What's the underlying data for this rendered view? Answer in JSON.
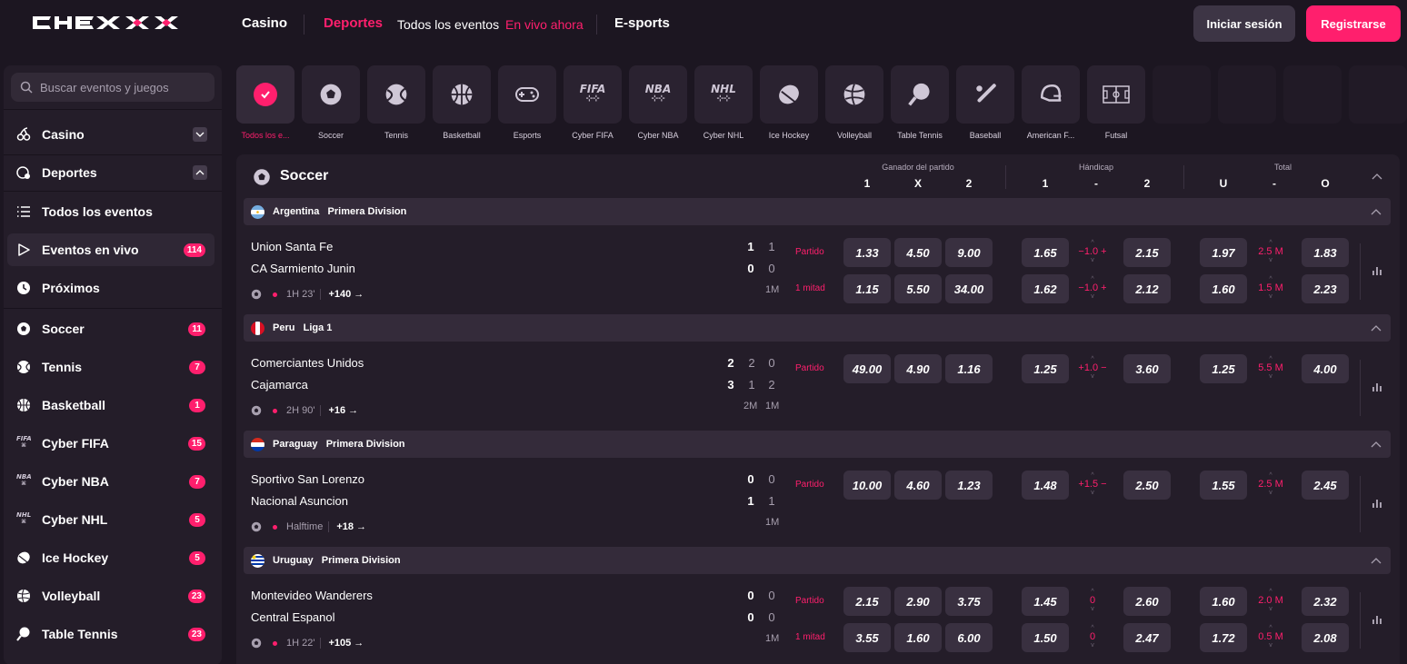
{
  "header": {
    "logo": "CHEXXX",
    "nav": [
      {
        "label": "Casino",
        "color": "#ffffff"
      },
      {
        "label": "Deportes",
        "color": "#ff1f6d"
      },
      {
        "label": "Todos los eventos",
        "color": "#ffffff"
      },
      {
        "label": "En vivo ahora",
        "color": "#ff1f6d"
      },
      {
        "label": "E-sports",
        "color": "#ffffff"
      }
    ],
    "login": "Iniciar sesión",
    "register": "Registrarse"
  },
  "sidebar": {
    "search_placeholder": "Buscar eventos y juegos",
    "items": [
      {
        "label": "Casino",
        "icon": "cherries-icon"
      },
      {
        "label": "Deportes",
        "icon": "sports-icon"
      },
      {
        "label": "Todos los eventos",
        "icon": "list-icon"
      },
      {
        "label": "Eventos en vivo",
        "icon": "play-icon",
        "badge": "114"
      },
      {
        "label": "Próximos",
        "icon": "clock-icon"
      },
      {
        "label": "Soccer",
        "icon": "soccer-icon",
        "badge": "11"
      },
      {
        "label": "Tennis",
        "icon": "tennis-icon",
        "badge": "7"
      },
      {
        "label": "Basketball",
        "icon": "basketball-icon",
        "badge": "1"
      },
      {
        "label": "Cyber FIFA",
        "icon": "fifa-icon",
        "badge": "15"
      },
      {
        "label": "Cyber NBA",
        "icon": "nba-icon",
        "badge": "7"
      },
      {
        "label": "Cyber NHL",
        "icon": "nhl-icon",
        "badge": "5"
      },
      {
        "label": "Ice Hockey",
        "icon": "hockey-icon",
        "badge": "5"
      },
      {
        "label": "Volleyball",
        "icon": "volleyball-icon",
        "badge": "23"
      },
      {
        "label": "Table Tennis",
        "icon": "table-tennis-icon",
        "badge": "23"
      }
    ]
  },
  "sports": [
    {
      "label": "Todos los e...",
      "icon": "check-icon"
    },
    {
      "label": "Soccer",
      "icon": "soccer-icon"
    },
    {
      "label": "Tennis",
      "icon": "tennis-icon"
    },
    {
      "label": "Basketball",
      "icon": "basketball-icon"
    },
    {
      "label": "Esports",
      "icon": "gamepad-icon"
    },
    {
      "label": "Cyber FIFA",
      "icon": "fifa-icon",
      "logo": "FIFA"
    },
    {
      "label": "Cyber NBA",
      "icon": "nba-icon",
      "logo": "NBA"
    },
    {
      "label": "Cyber NHL",
      "icon": "nhl-icon",
      "logo": "NHL"
    },
    {
      "label": "Ice Hockey",
      "icon": "hockey-icon"
    },
    {
      "label": "Volleyball",
      "icon": "volleyball-icon"
    },
    {
      "label": "Table Tennis",
      "icon": "table-tennis-icon"
    },
    {
      "label": "Baseball",
      "icon": "baseball-icon"
    },
    {
      "label": "American F...",
      "icon": "football-helmet-icon"
    },
    {
      "label": "Futsal",
      "icon": "futsal-icon"
    }
  ],
  "section": {
    "title": "Soccer",
    "groups": [
      {
        "label": "Ganador del partido",
        "cols": [
          "1",
          "X",
          "2"
        ]
      },
      {
        "label": "Hándicap",
        "cols": [
          "1",
          "-",
          "2"
        ]
      },
      {
        "label": "Total",
        "cols": [
          "U",
          "-",
          "O"
        ]
      }
    ]
  },
  "leagues": [
    {
      "country": "Argentina",
      "name": "Primera Division",
      "match": {
        "home": "Union Santa Fe",
        "away": "CA Sarmiento Junin",
        "scores": [
          [
            "1",
            "1"
          ],
          [
            "0",
            "0"
          ]
        ],
        "periods": [
          "1M"
        ],
        "status": "1H 23'",
        "more": "+140 →",
        "markets": [
          {
            "name": "Partido",
            "w": [
              "1.33",
              "4.50",
              "9.00"
            ],
            "h": [
              "1.65",
              "−1.0 +",
              "2.15"
            ],
            "t": [
              "1.97",
              "2.5 M",
              "1.83"
            ]
          },
          {
            "name": "1 mitad",
            "w": [
              "1.15",
              "5.50",
              "34.00"
            ],
            "h": [
              "1.62",
              "−1.0 +",
              "2.12"
            ],
            "t": [
              "1.60",
              "1.5 M",
              "2.23"
            ]
          }
        ]
      }
    },
    {
      "country": "Peru",
      "name": "Liga 1",
      "match": {
        "home": "Comerciantes Unidos",
        "away": "Cajamarca",
        "scores": [
          [
            "2",
            "2",
            "0"
          ],
          [
            "3",
            "1",
            "2"
          ]
        ],
        "periods": [
          "2M",
          "1M"
        ],
        "status": "2H 90'",
        "more": "+16 →",
        "markets": [
          {
            "name": "Partido",
            "w": [
              "49.00",
              "4.90",
              "1.16"
            ],
            "h": [
              "1.25",
              "+1.0 −",
              "3.60"
            ],
            "t": [
              "1.25",
              "5.5 M",
              "4.00"
            ]
          }
        ]
      }
    },
    {
      "country": "Paraguay",
      "name": "Primera Division",
      "match": {
        "home": "Sportivo San Lorenzo",
        "away": "Nacional Asuncion",
        "scores": [
          [
            "0",
            "0"
          ],
          [
            "1",
            "1"
          ]
        ],
        "periods": [
          "1M"
        ],
        "status": "Halftime",
        "more": "+18 →",
        "markets": [
          {
            "name": "Partido",
            "w": [
              "10.00",
              "4.60",
              "1.23"
            ],
            "h": [
              "1.48",
              "+1.5 −",
              "2.50"
            ],
            "t": [
              "1.55",
              "2.5 M",
              "2.45"
            ]
          }
        ]
      }
    },
    {
      "country": "Uruguay",
      "name": "Primera Division",
      "match": {
        "home": "Montevideo Wanderers",
        "away": "Central Espanol",
        "scores": [
          [
            "0",
            "0"
          ],
          [
            "0",
            "0"
          ]
        ],
        "periods": [
          "1M"
        ],
        "status": "1H 22'",
        "more": "+105 →",
        "markets": [
          {
            "name": "Partido",
            "w": [
              "2.15",
              "2.90",
              "3.75"
            ],
            "h": [
              "1.45",
              "0",
              "2.60"
            ],
            "t": [
              "1.60",
              "2.0 M",
              "2.32"
            ]
          },
          {
            "name": "1 mitad",
            "w": [
              "3.55",
              "1.60",
              "6.00"
            ],
            "h": [
              "1.50",
              "0",
              "2.47"
            ],
            "t": [
              "1.72",
              "0.5 M",
              "2.08"
            ]
          }
        ]
      }
    }
  ],
  "colors": {
    "accent": "#ff1f6d",
    "bg": "#1c1621",
    "panel": "#241d29",
    "odd": "#393040"
  }
}
